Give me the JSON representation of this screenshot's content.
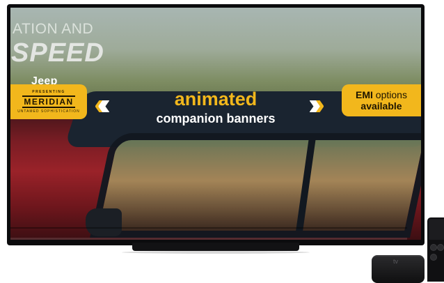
{
  "headline": {
    "line1": "ATION AND",
    "line2": "SPEED"
  },
  "brand": {
    "logo": "Jeep"
  },
  "badge_left": {
    "presenting": "PRESENTING",
    "name": "MERIDIAN",
    "subtitle": "UNTAMED SOPHISTICATION"
  },
  "chevrons": {
    "left": "«‹",
    "right": "»›"
  },
  "tagline": {
    "line1": "animated",
    "line2": "companion banners"
  },
  "badge_right": {
    "bold": "EMI",
    "line1_rest": " options",
    "line2": "available"
  },
  "device": {
    "logo": "tv"
  },
  "colors": {
    "accent": "#f2b71c",
    "bezel": "#0b0b0d",
    "car_red": "#9a2229"
  }
}
